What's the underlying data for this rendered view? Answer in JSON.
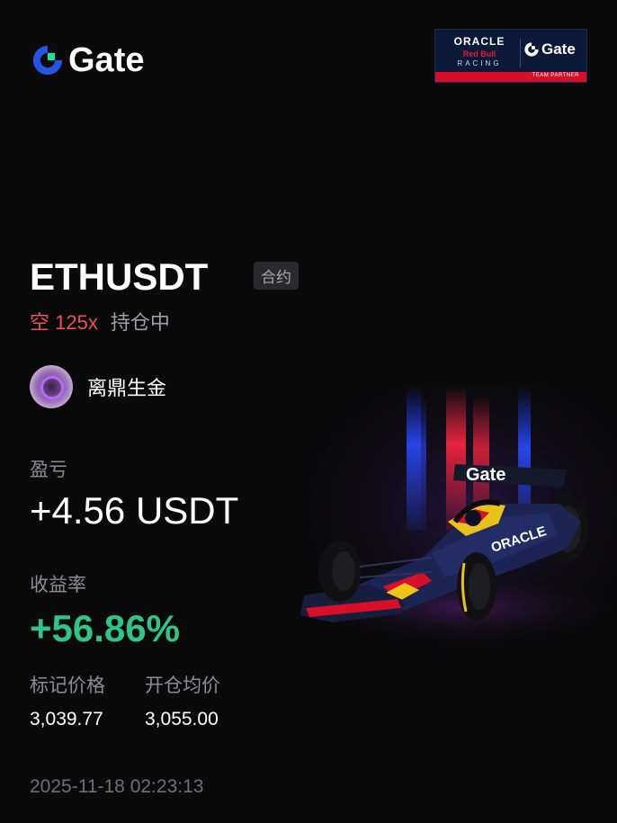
{
  "brand": {
    "name": "Gate"
  },
  "partner": {
    "oracle": "ORACLE",
    "red_bull": "Red Bull",
    "racing": "RACING",
    "gate": "Gate",
    "footer": "TEAM PARTNER"
  },
  "position": {
    "symbol": "ETHUSDT",
    "type_tag": "合约",
    "side": "空 125x",
    "status": "持仓中"
  },
  "user": {
    "name": "离鼎生金"
  },
  "pnl": {
    "label": "盈亏",
    "value": "+4.56 USDT"
  },
  "return_rate": {
    "label": "收益率",
    "value": "+56.86%"
  },
  "mark_price": {
    "label": "标记价格",
    "value": "3,039.77"
  },
  "entry_price": {
    "label": "开仓均价",
    "value": "3,055.00"
  },
  "timestamp": "2025-11-18 02:23:13",
  "car": {
    "wing_text": "Gate",
    "side_text": "ORACLE"
  },
  "colors": {
    "background": "#0a0a0b",
    "gate_blue": "#2354e6",
    "gate_green": "#17e6a1",
    "short_red": "#ef4f5c",
    "profit_green": "#2fc58a"
  }
}
